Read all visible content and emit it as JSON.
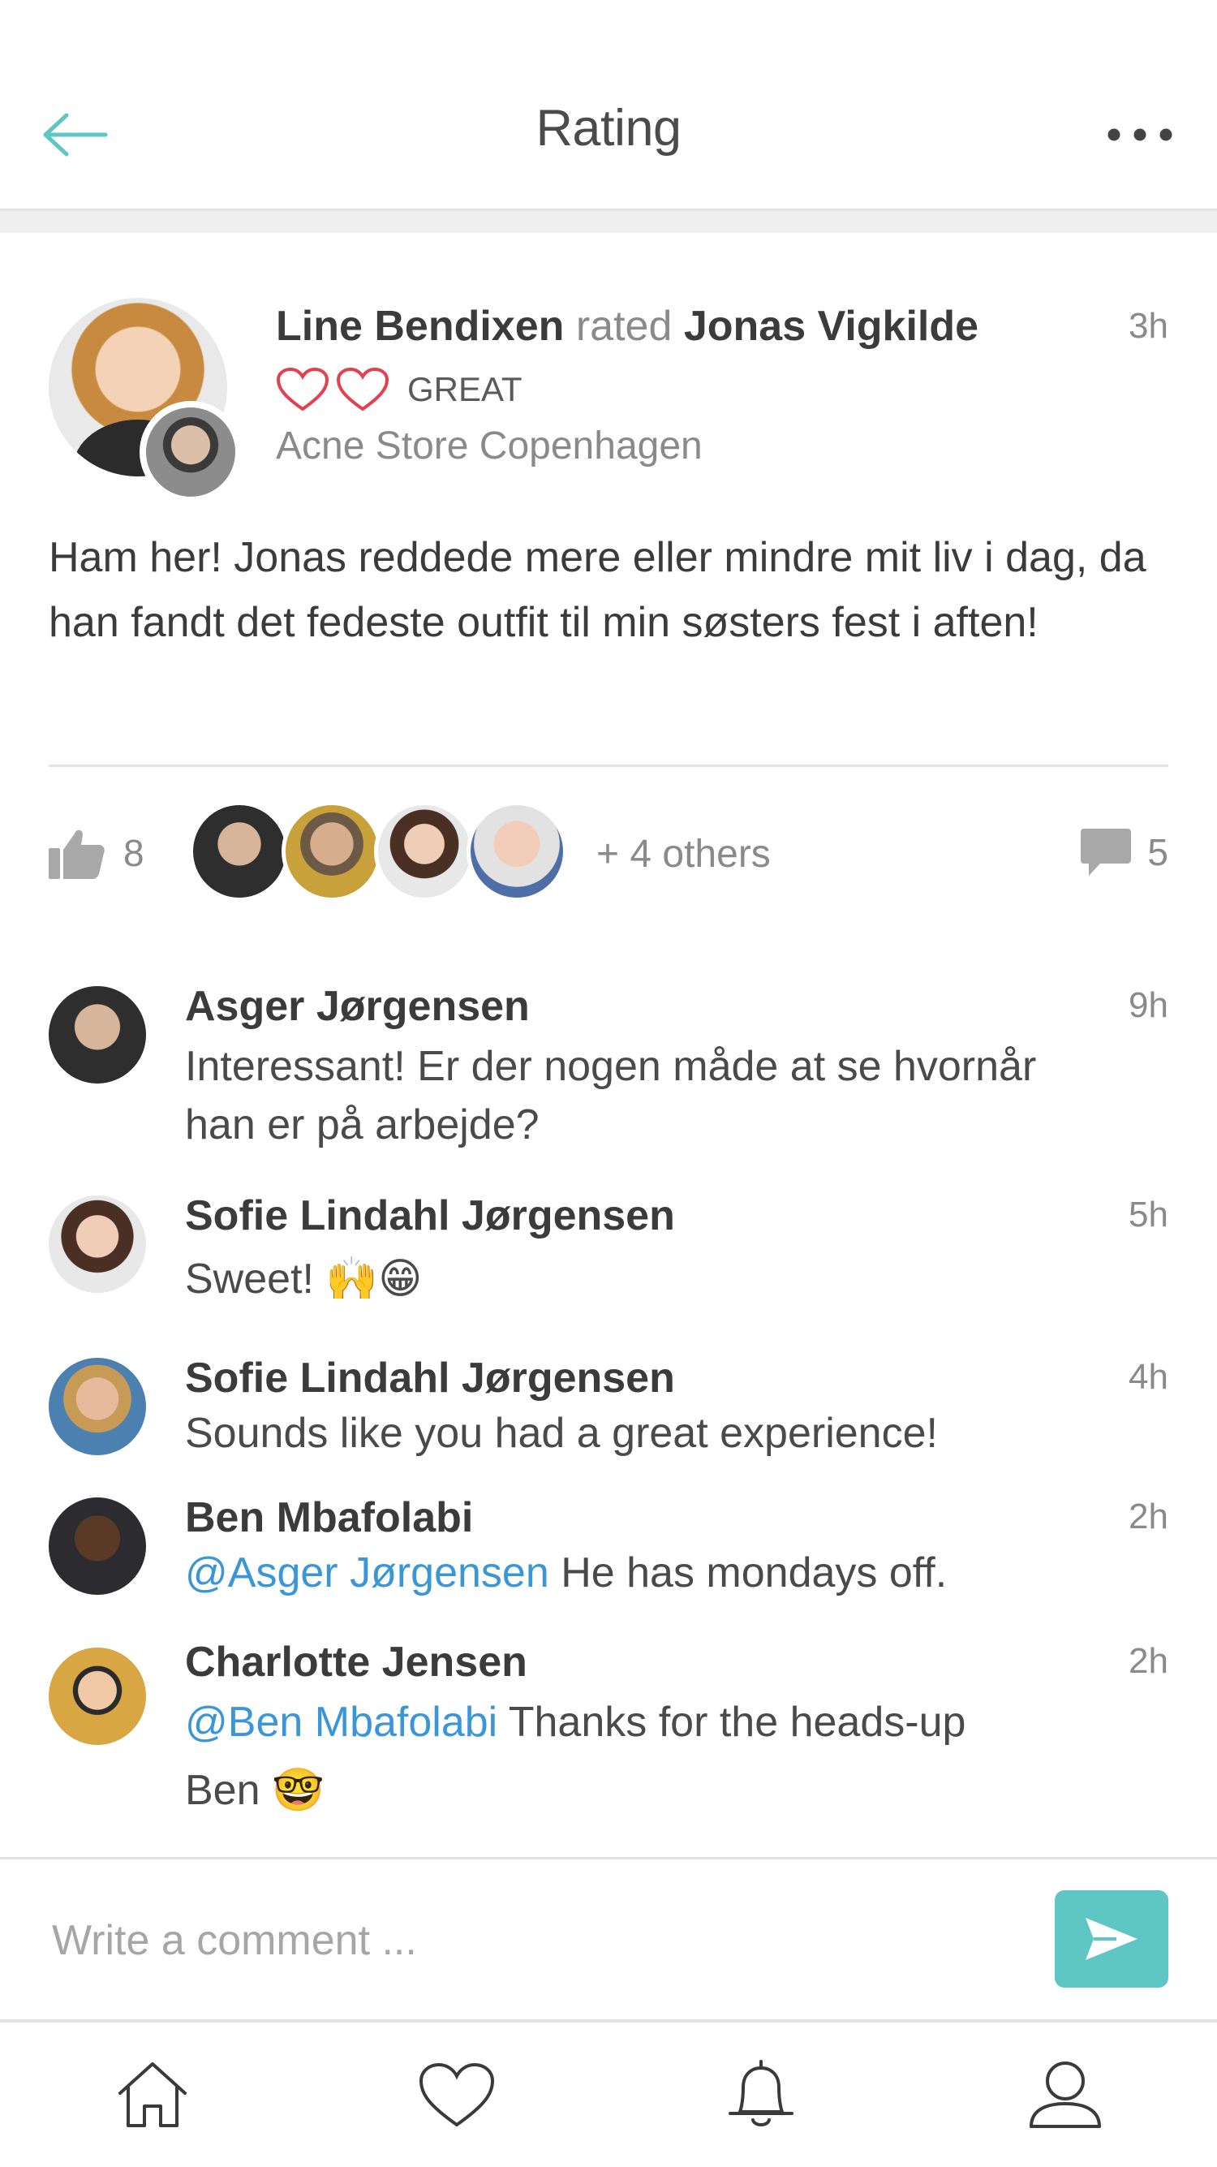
{
  "header": {
    "title": "Rating",
    "back_icon": "arrow-left-icon",
    "more_icon": "more-horizontal-icon",
    "accent_color": "#5ec7c4"
  },
  "post": {
    "rater": "Line Bendixen",
    "verb": "rated",
    "ratee": "Jonas Vigkilde",
    "time": "3h",
    "rating_hearts": 2,
    "rating_label": "GREAT",
    "heart_color": "#e4414e",
    "location": "Acne Store Copenhagen",
    "body": "Ham her! Jonas reddede mere eller mindre mit liv i dag, da han fandt det fedeste outfit til min søsters fest i aften!"
  },
  "social": {
    "like_count": "8",
    "others": "+ 4 others",
    "comment_count": "5"
  },
  "comments": [
    {
      "name": "Asger Jørgensen",
      "time": "9h",
      "mention": "",
      "text": "Interessant! Er der nogen måde at se hvornår han er på arbejde?"
    },
    {
      "name": "Sofie Lindahl Jørgensen",
      "time": "5h",
      "mention": "",
      "text": "Sweet! 🙌😁"
    },
    {
      "name": "Sofie Lindahl Jørgensen",
      "time": "4h",
      "mention": "",
      "text": "Sounds like you had a great experience!"
    },
    {
      "name": "Ben Mbafolabi",
      "time": "2h",
      "mention": "@Asger Jørgensen",
      "text": " He has mondays off."
    },
    {
      "name": "Charlotte Jensen",
      "time": "2h",
      "mention": "@Ben Mbafolabi",
      "text": " Thanks for the heads-up Ben 🤓"
    }
  ],
  "compose": {
    "placeholder": "Write a comment ...",
    "send_icon": "send-icon"
  },
  "tabbar": {
    "items": [
      "home-icon",
      "heart-icon",
      "bell-icon",
      "profile-icon"
    ]
  }
}
